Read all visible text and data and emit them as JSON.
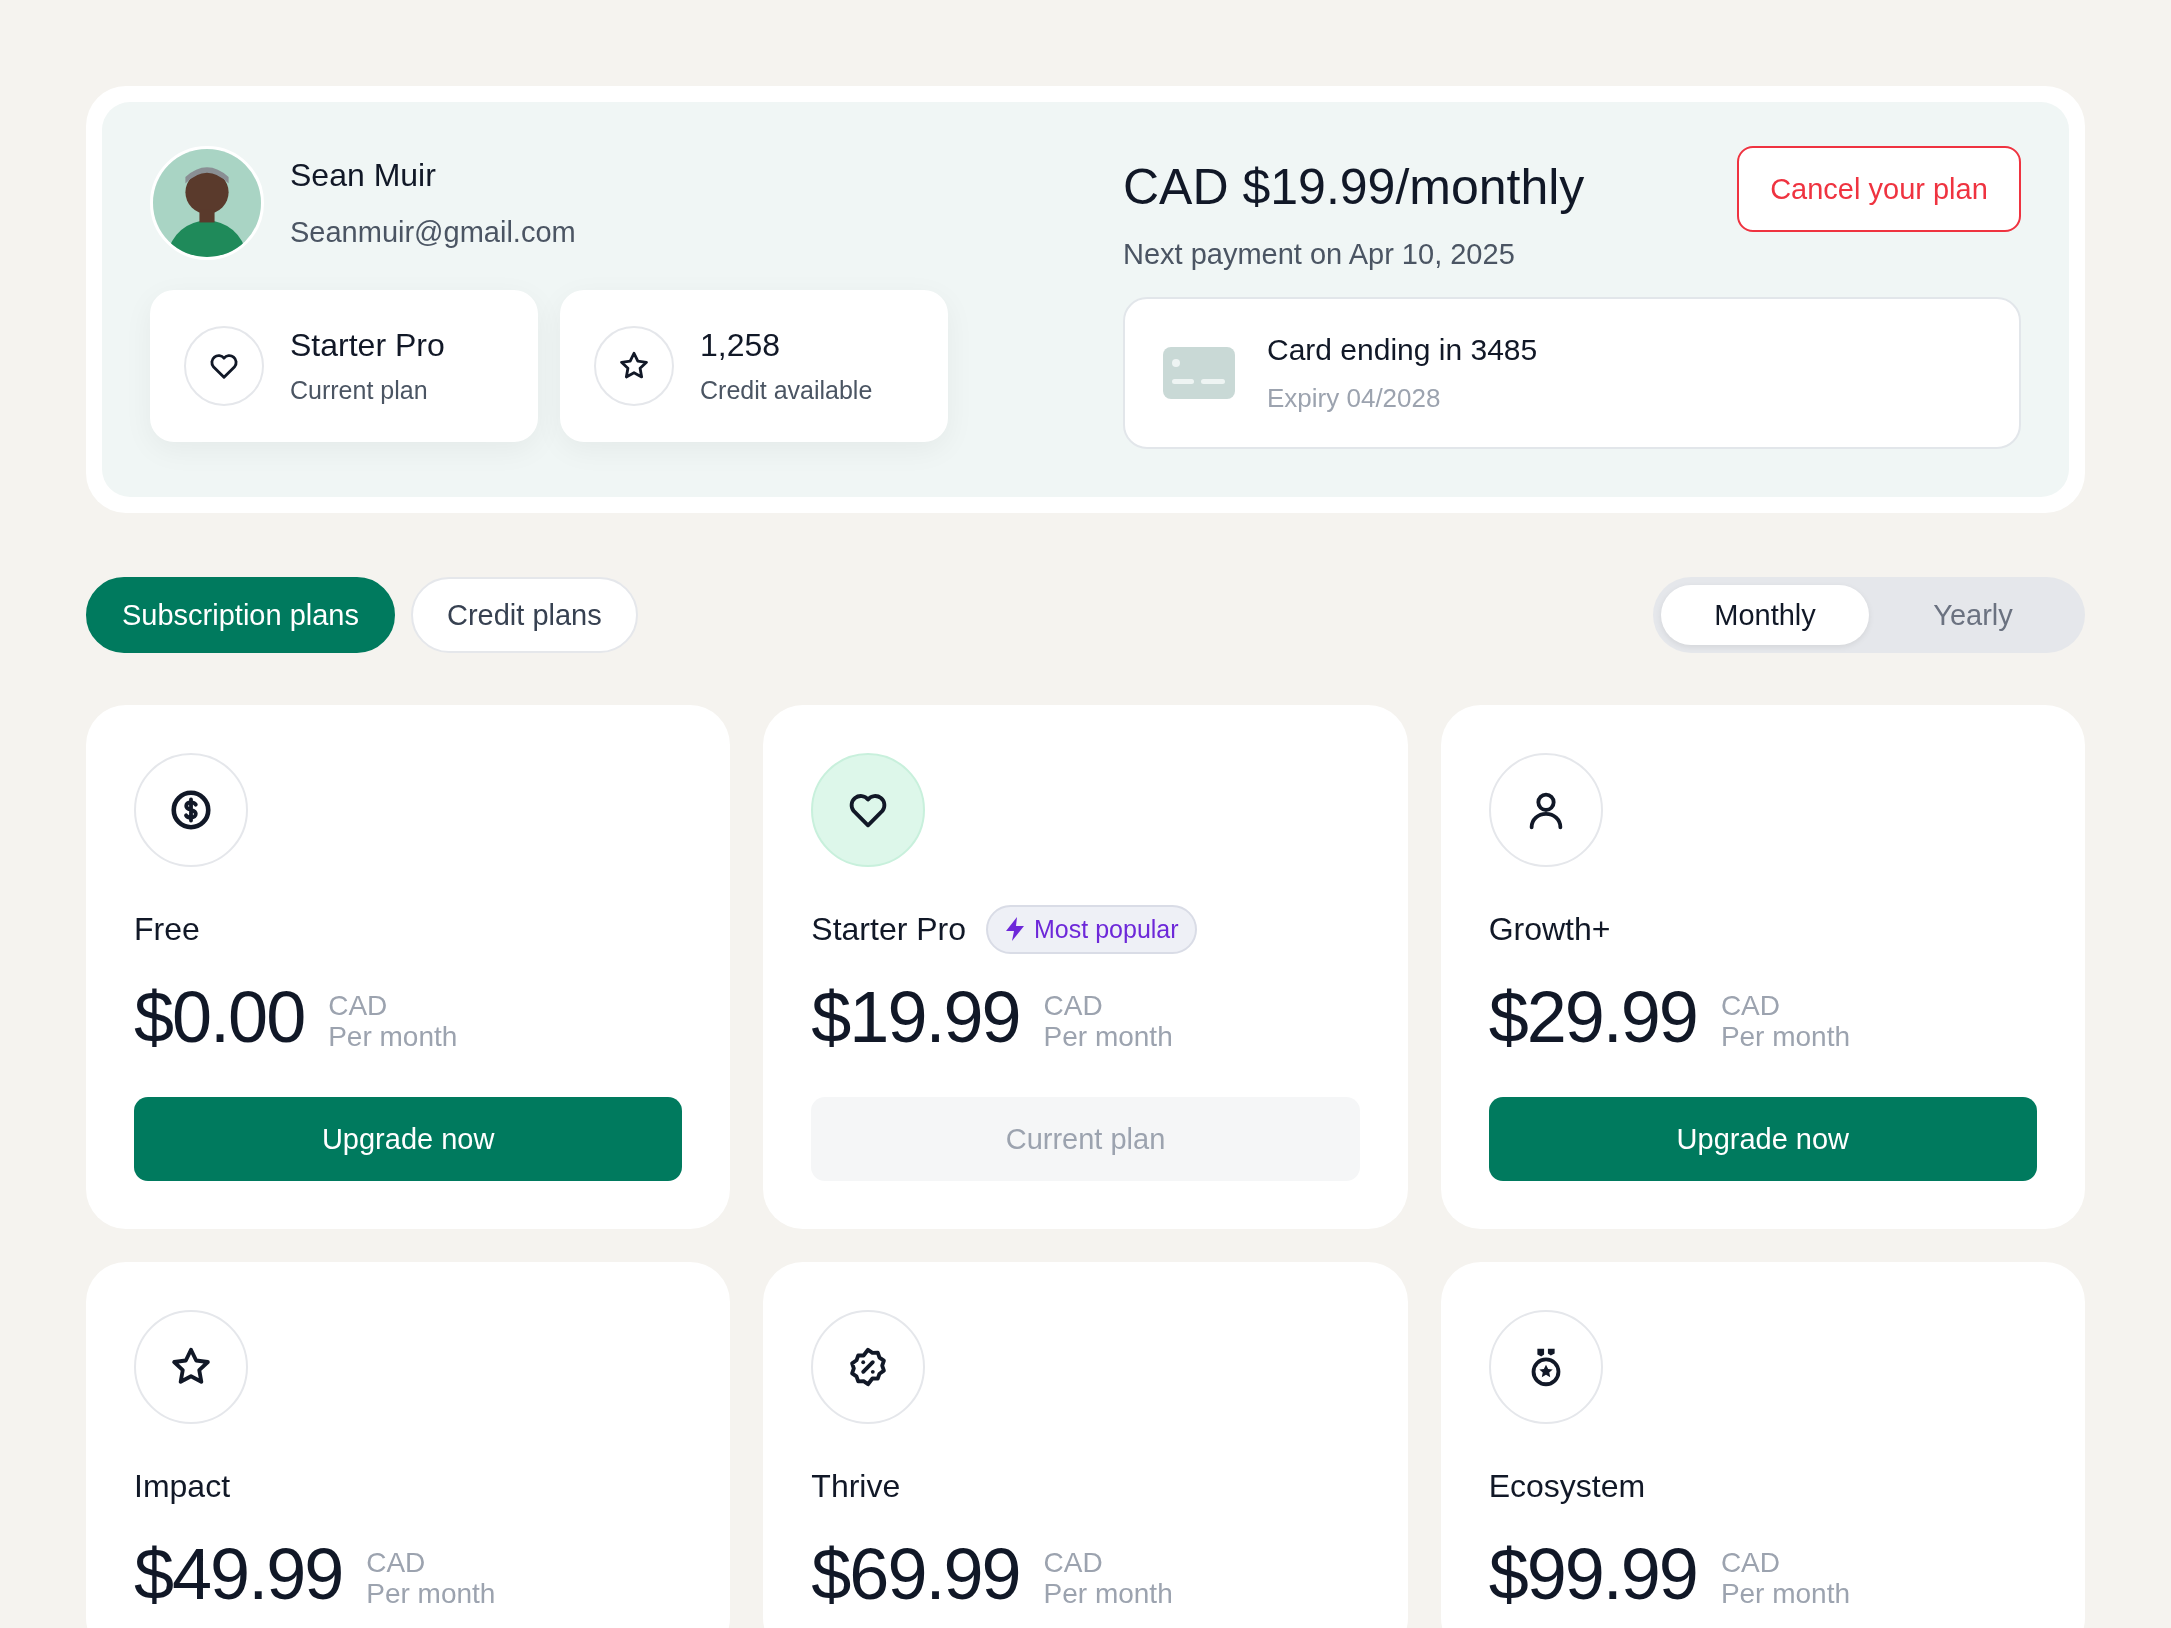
{
  "account": {
    "name": "Sean Muir",
    "email": "Seanmuir@gmail.com",
    "stats": [
      {
        "kind": "heart",
        "value": "Starter Pro",
        "label": "Current plan"
      },
      {
        "kind": "star",
        "value": "1,258",
        "label": "Credit available"
      }
    ]
  },
  "billing": {
    "price": "CAD $19.99/monthly",
    "next_payment": "Next payment on Apr 10, 2025",
    "cancel_button": "Cancel your plan",
    "card": {
      "title": "Card ending in 3485",
      "expiry": "Expiry 04/2028"
    }
  },
  "plan_tabs": [
    {
      "label": "Subscription plans",
      "selected": true
    },
    {
      "label": "Credit plans",
      "selected": false
    }
  ],
  "period_toggle": [
    {
      "label": "Monthly",
      "selected": true
    },
    {
      "label": "Yearly",
      "selected": false
    }
  ],
  "plans": [
    {
      "kind": "dollar",
      "name": "Free",
      "price": "$0.00",
      "currency": "CAD",
      "period": "Per month",
      "current": false,
      "button": {
        "label": "Upgrade now",
        "kind": "primary"
      }
    },
    {
      "kind": "heart",
      "name": "Starter Pro",
      "badge": "Most popular",
      "price": "$19.99",
      "currency": "CAD",
      "period": "Per month",
      "current": true,
      "button": {
        "label": "Current plan",
        "kind": "current"
      }
    },
    {
      "kind": "person",
      "name": "Growth+",
      "price": "$29.99",
      "currency": "CAD",
      "period": "Per month",
      "current": false,
      "button": {
        "label": "Upgrade now",
        "kind": "primary"
      }
    },
    {
      "kind": "star",
      "name": "Impact",
      "price": "$49.99",
      "currency": "CAD",
      "period": "Per month",
      "current": false
    },
    {
      "kind": "discount",
      "name": "Thrive",
      "price": "$69.99",
      "currency": "CAD",
      "period": "Per month",
      "current": false
    },
    {
      "kind": "medal",
      "name": "Ecosystem",
      "price": "$99.99",
      "currency": "CAD",
      "period": "Per month",
      "current": false
    }
  ]
}
